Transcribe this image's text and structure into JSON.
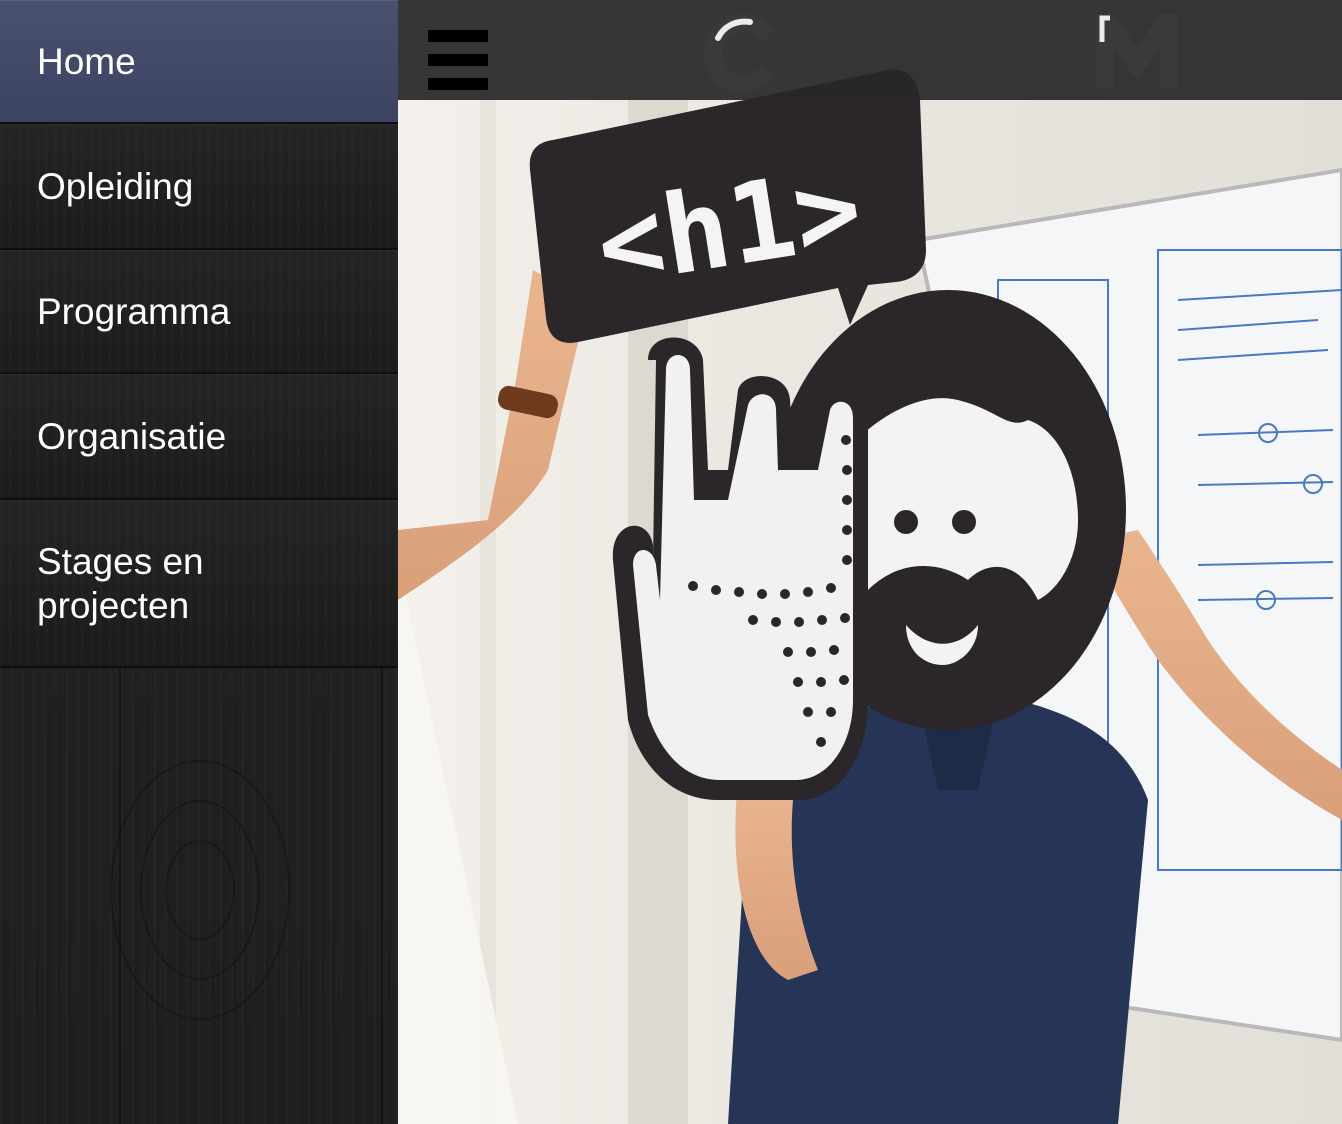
{
  "menu": {
    "items": [
      {
        "label": "Home"
      },
      {
        "label": "Opleiding"
      },
      {
        "label": "Programma"
      },
      {
        "label": "Organisatie"
      },
      {
        "label": "Stages en projecten"
      }
    ],
    "active_index": 0
  },
  "header": {
    "menu_icon": "hamburger-icon",
    "logo_left": "c-logo-icon",
    "logo_right": "m-logo-icon"
  },
  "hero": {
    "speech_bubble_text": "<h1>",
    "description_icons": [
      "speech-bubble",
      "rock-hand-icon",
      "bearded-face-icon",
      "whiteboard-wireframe"
    ]
  },
  "colors": {
    "active_menu": "#434a6a",
    "menu_bg": "#1f1f1f",
    "header_bg": "#2a2a2a"
  }
}
